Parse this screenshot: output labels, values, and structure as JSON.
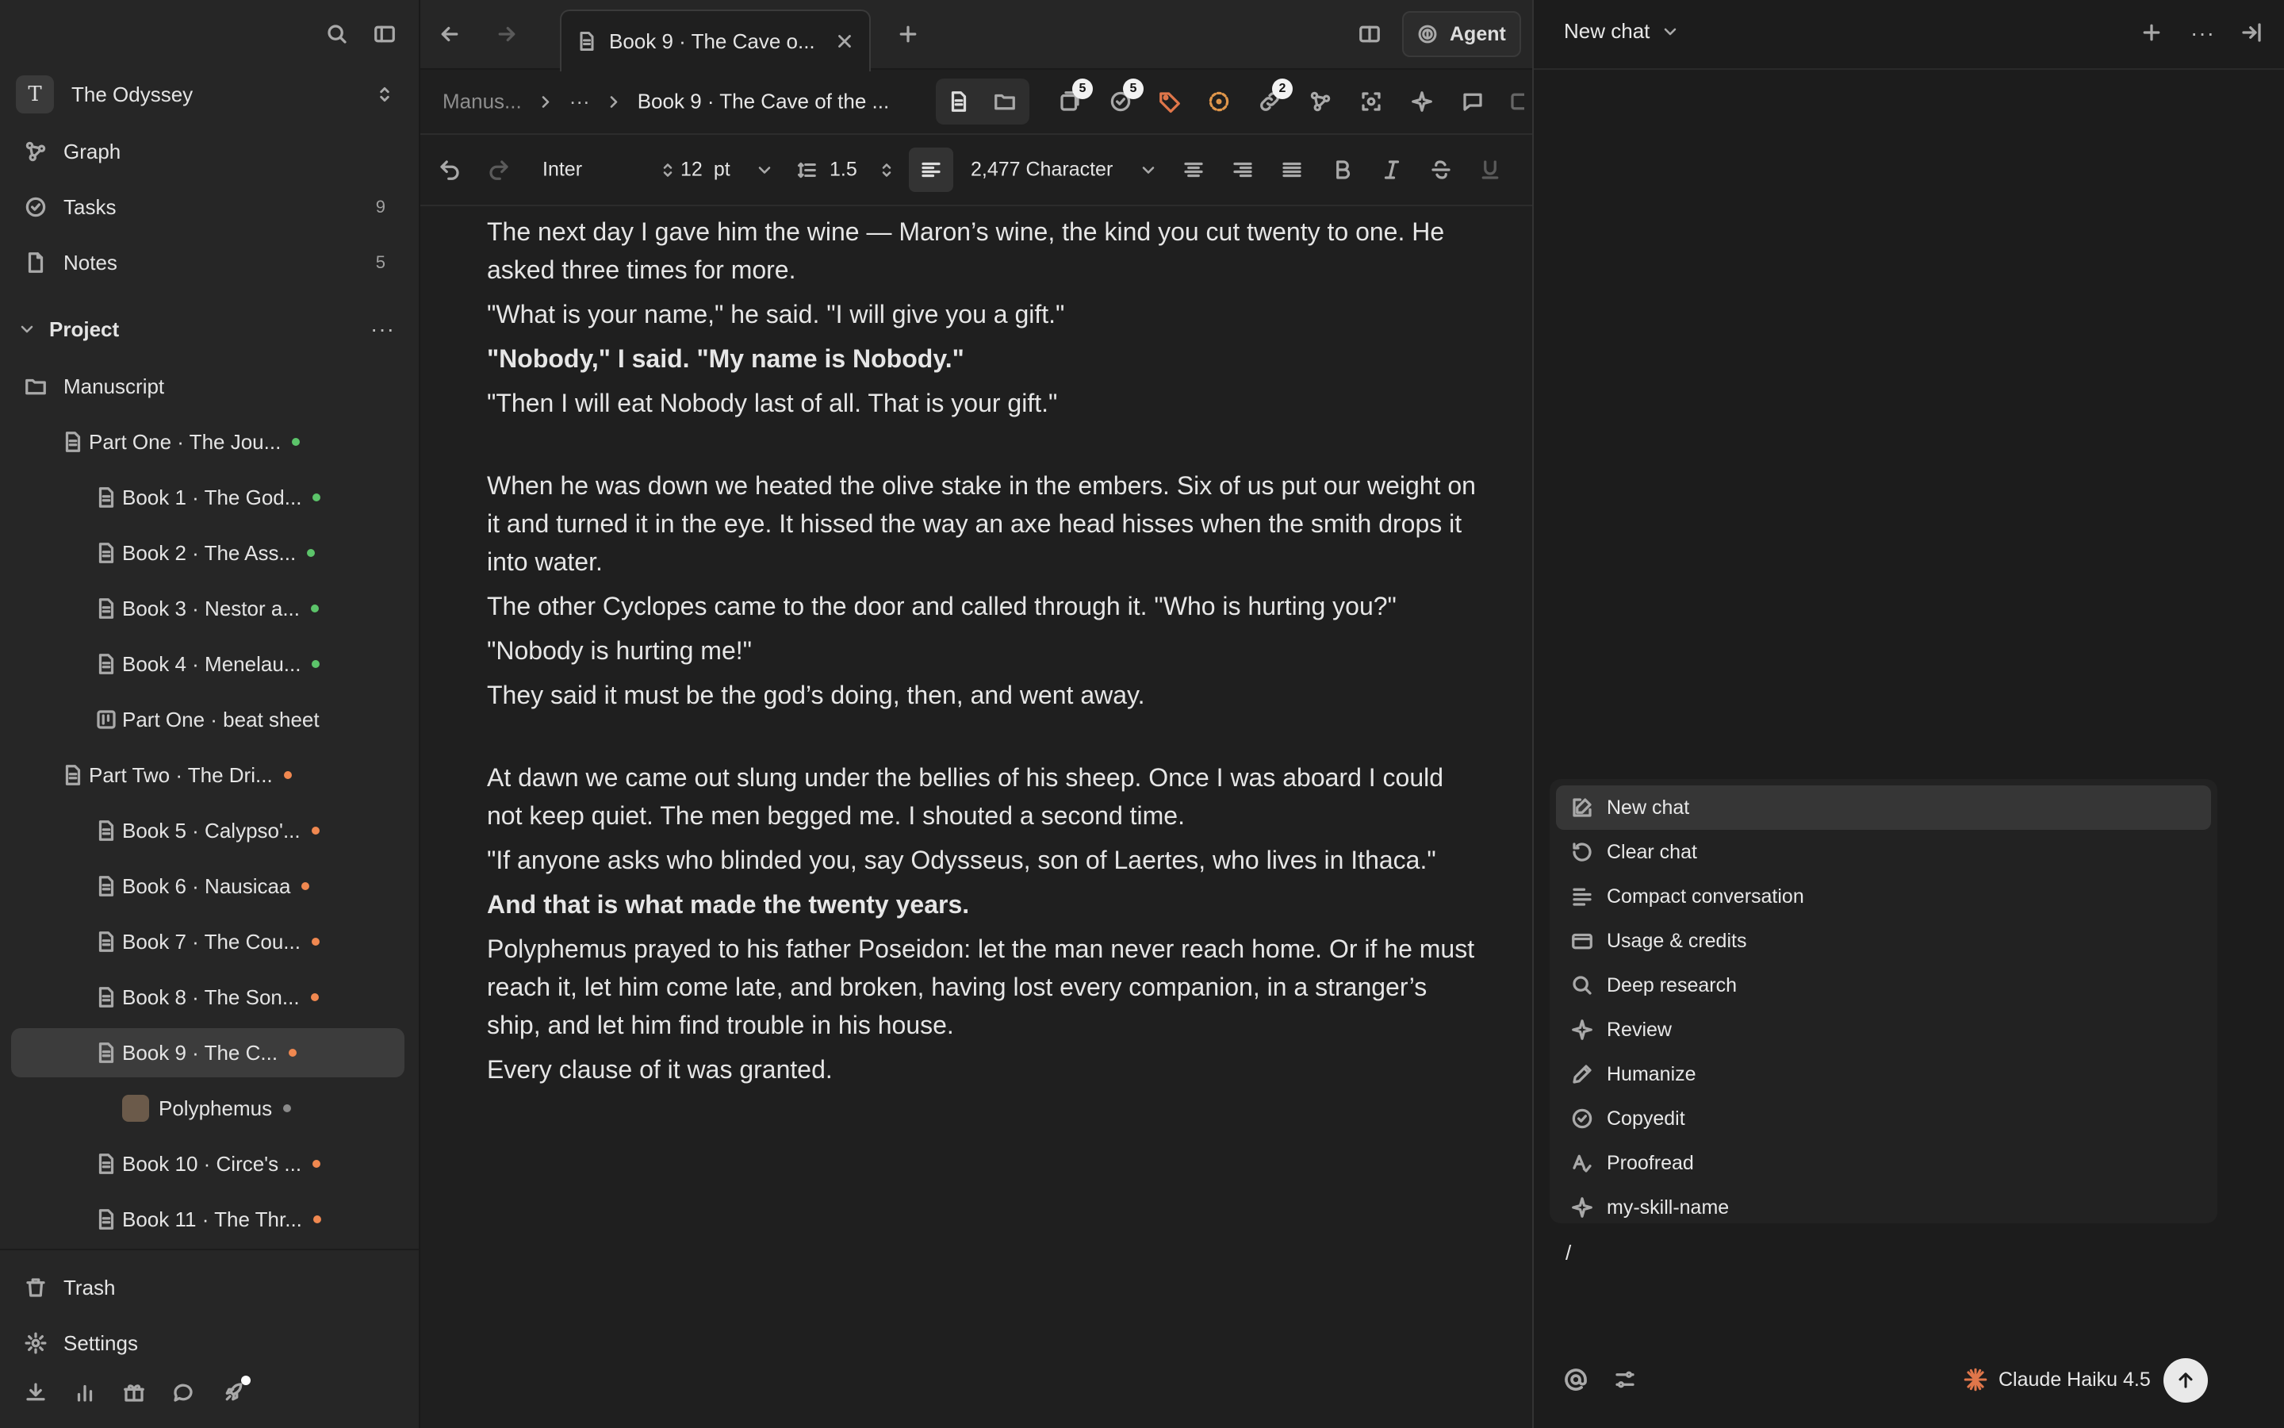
{
  "sidebar": {
    "workspace_initial": "T",
    "workspace_name": "The Odyssey",
    "nav": [
      {
        "label": "Graph",
        "count": ""
      },
      {
        "label": "Tasks",
        "count": "9"
      },
      {
        "label": "Notes",
        "count": "5"
      }
    ],
    "project_label": "Project",
    "tree": [
      {
        "label": "Manuscript"
      },
      {
        "label": "Part One · The Jou..."
      },
      {
        "label": "Book 1 · The God..."
      },
      {
        "label": "Book 2 · The Ass..."
      },
      {
        "label": "Book 3 · Nestor a..."
      },
      {
        "label": "Book 4 · Menelau..."
      },
      {
        "label": "Part One · beat sheet"
      },
      {
        "label": "Part Two · The Dri..."
      },
      {
        "label": "Book 5 · Calypso'..."
      },
      {
        "label": "Book 6 · Nausicaa"
      },
      {
        "label": "Book 7 · The Cou..."
      },
      {
        "label": "Book 8 · The Son..."
      },
      {
        "label": "Book 9 · The C..."
      },
      {
        "label": "Polyphemus"
      },
      {
        "label": "Book 10 · Circe's ..."
      },
      {
        "label": "Book 11 · The Thr..."
      }
    ],
    "trash_label": "Trash",
    "settings_label": "Settings"
  },
  "tabs": {
    "active_tab": "Book 9 · The Cave o...",
    "agent_label": "Agent"
  },
  "breadcrumb": {
    "root": "Manus...",
    "ellipsis": "···",
    "current": "Book 9 · The Cave of the ...",
    "badge_outline": "5",
    "badge_tasks": "5",
    "badge_links": "2"
  },
  "format": {
    "font": "Inter",
    "size": "12",
    "unit": "pt",
    "line_height": "1.5",
    "count": "2,477 Character"
  },
  "doc": {
    "p1": "The next day I gave him the wine — Maron’s wine, the kind you cut twenty to one. He asked three times for more.",
    "p2": "\"What is your name,\" he said. \"I will give you a gift.\"",
    "p3": "\"Nobody,\" I said. \"My name is Nobody.\"",
    "p4": "\"Then I will eat Nobody last of all. That is your gift.\"",
    "p5": "When he was down we heated the olive stake in the embers. Six of us put our weight on it and turned it in the eye. It hissed the way an axe head hisses when the smith drops it into water.",
    "p6": "The other Cyclopes came to the door and called through it. \"Who is hurting you?\"",
    "p7": "\"Nobody is hurting me!\"",
    "p8": "They said it must be the god’s doing, then, and went away.",
    "p9": "At dawn we came out slung under the bellies of his sheep. Once I was aboard I could not keep quiet. The men begged me. I shouted a second time.",
    "p10": "\"If anyone asks who blinded you, say Odysseus, son of Laertes, who lives in Ithaca.\"",
    "p11": "And that is what made the twenty years.",
    "p12": "Polyphemus prayed to his father Poseidon: let the man never reach home. Or if he must reach it, let him come late, and broken, having lost every companion, in a stranger’s ship, and let him find trouble in his house.",
    "p13": "Every clause of it was granted."
  },
  "chat": {
    "title": "New chat",
    "menu": [
      {
        "label": "New chat"
      },
      {
        "label": "Clear chat"
      },
      {
        "label": "Compact conversation"
      },
      {
        "label": "Usage & credits"
      },
      {
        "label": "Deep research"
      },
      {
        "label": "Review"
      },
      {
        "label": "Humanize"
      },
      {
        "label": "Copyedit"
      },
      {
        "label": "Proofread"
      },
      {
        "label": "my-skill-name"
      }
    ],
    "input_value": "/",
    "model": "Claude Haiku 4.5",
    "accent": "#e0764a"
  }
}
